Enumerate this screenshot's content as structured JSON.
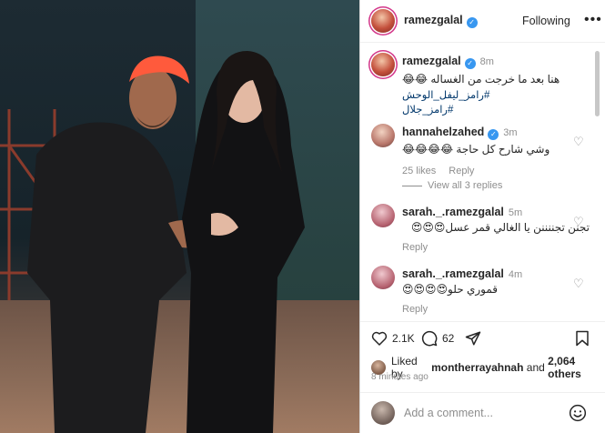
{
  "post": {
    "photo_alt": "Photo of two people on a stage set",
    "author": "ramezgalal",
    "follow_label": "Following",
    "more_label": "•••"
  },
  "caption": {
    "username": "ramezgalal",
    "time": "8m",
    "text": "هنا بعد ما خرجت من الغساله 😂😂",
    "tags": [
      "#رامز_ليفل_الوحش",
      "#رامز_جلال"
    ]
  },
  "comments": [
    {
      "username": "hannahelzahed",
      "time": "3m",
      "text": "وشي شارح كل حاجة 😂😂😂😂",
      "likes": "25 likes",
      "reply": "Reply"
    },
    {
      "username": "sarah._.ramezgalal",
      "time": "5m",
      "text": "تجنن تجننننن يا الغالي قمر عسل😍😍😍",
      "reply": "Reply"
    },
    {
      "username": "sarah._.ramezgalal",
      "time": "4m",
      "text": "قموري حلو😍😍😍😍",
      "reply": "Reply"
    }
  ],
  "view_replies": "View all 3 replies",
  "actions": {
    "likes_count": "2.1K",
    "comments_count": "62"
  },
  "liked_by": {
    "prefix": "Liked by",
    "user": "montherrayahnah",
    "and": "and",
    "others": "2,064 others"
  },
  "timestamp": "8 minutes ago",
  "composer": {
    "placeholder": "Add a comment..."
  },
  "colors": {
    "verified": "#3897f0",
    "link": "#00376b",
    "muted": "#8e8e8e",
    "story_ring": "#d3378a"
  }
}
